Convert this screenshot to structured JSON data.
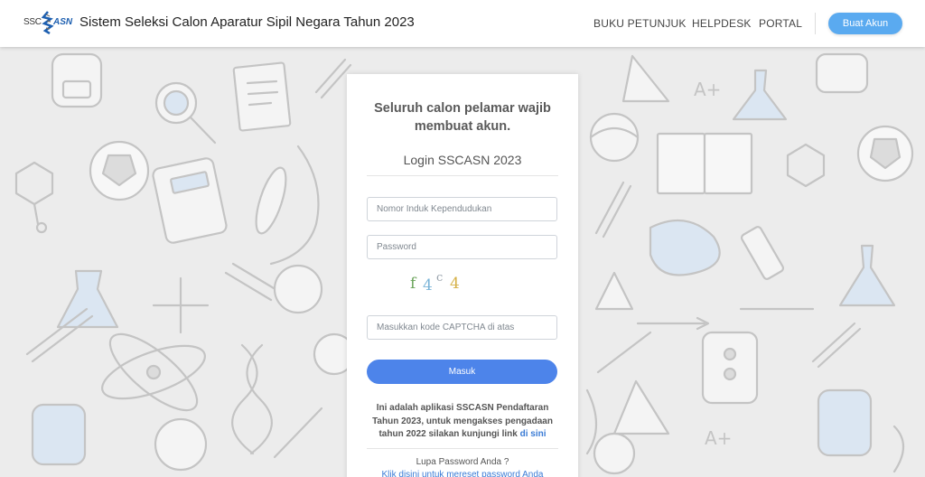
{
  "header": {
    "logo_ssc": "SSC",
    "logo_asn": "ASN",
    "title": "Sistem Seleksi Calon Aparatur Sipil Negara Tahun 2023",
    "nav": [
      "BUKU PETUNJUK",
      "HELPDESK",
      "PORTAL"
    ],
    "create_account": "Buat Akun"
  },
  "login": {
    "heading": "Seluruh calon pelamar wajib membuat akun.",
    "subtitle": "Login SSCASN 2023",
    "nik_placeholder": "Nomor Induk Kependudukan",
    "password_placeholder": "Password",
    "captcha_chars": [
      "f",
      "4",
      "c",
      "4"
    ],
    "captcha_placeholder": "Masukkan kode CAPTCHA di atas",
    "submit": "Masuk",
    "info_text": "Ini adalah aplikasi SSCASN Pendaftaran Tahun 2023, untuk mengakses pengadaan tahun 2022 silakan kunjungi link",
    "info_link": "di sini",
    "forgot": "Lupa Password Anda ?",
    "reset_link": "Klik disini untuk mereset password Anda"
  },
  "colors": {
    "primary": "#4d84ea",
    "accent": "#5aaaf0",
    "link": "#3a7bd5",
    "doodle_stroke": "#c4c4c4",
    "doodle_fill": "#dbe6f2"
  },
  "icons": [
    "sscasn-logo-icon"
  ]
}
